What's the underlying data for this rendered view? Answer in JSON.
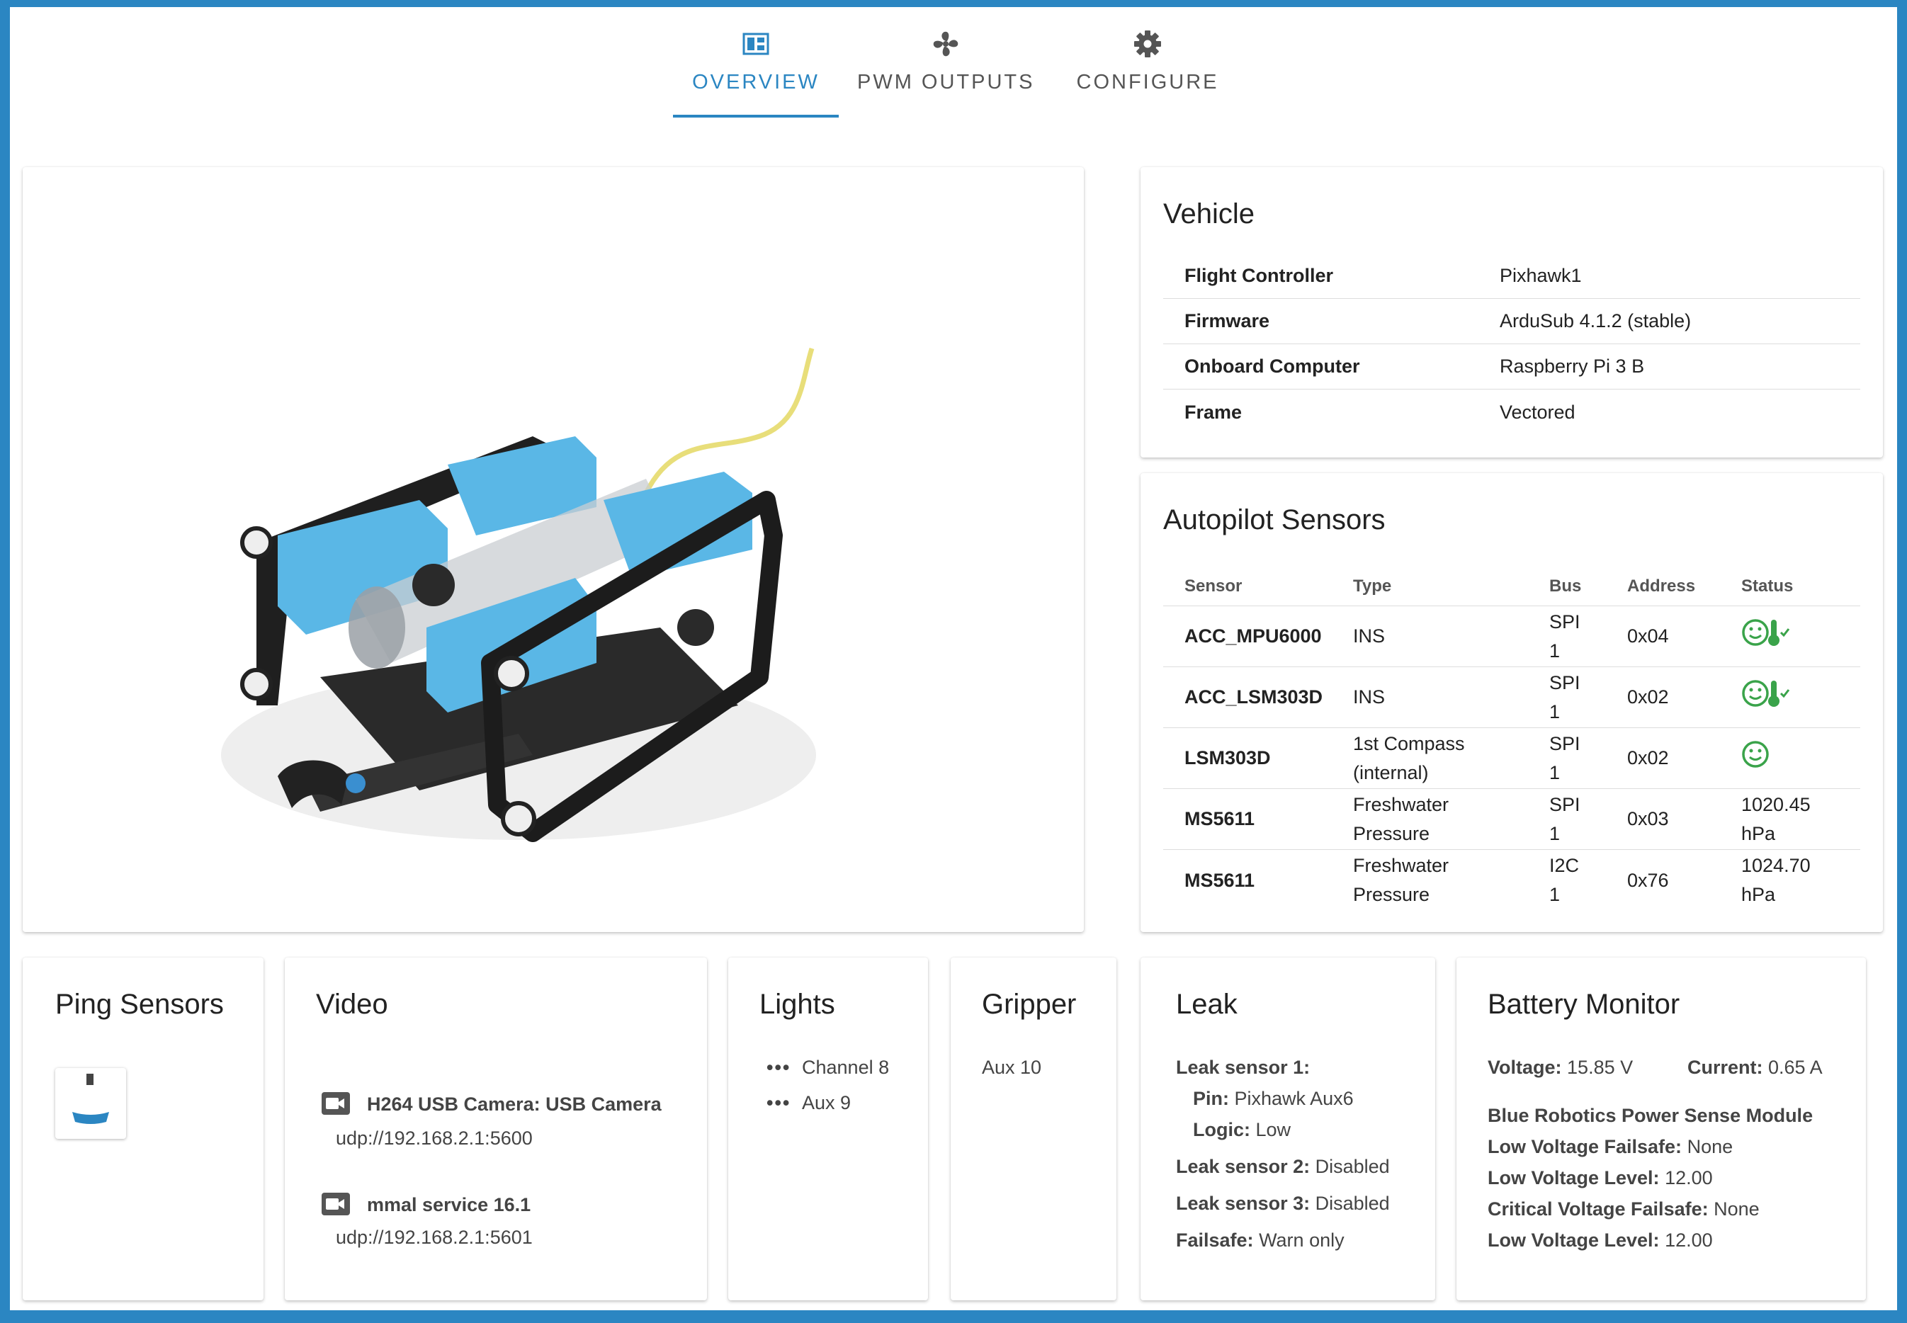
{
  "tabs": [
    {
      "label": "OVERVIEW",
      "icon": "dashboard-icon",
      "active": true
    },
    {
      "label": "PWM OUTPUTS",
      "icon": "fan-icon",
      "active": false
    },
    {
      "label": "CONFIGURE",
      "icon": "gear-icon",
      "active": false
    }
  ],
  "vehicle": {
    "title": "Vehicle",
    "rows": [
      {
        "key": "Flight Controller",
        "value": "Pixhawk1"
      },
      {
        "key": "Firmware",
        "value": "ArduSub 4.1.2 (stable)"
      },
      {
        "key": "Onboard Computer",
        "value": "Raspberry Pi 3 B"
      },
      {
        "key": "Frame",
        "value": "Vectored"
      }
    ]
  },
  "sensors": {
    "title": "Autopilot Sensors",
    "headers": [
      "Sensor",
      "Type",
      "Bus",
      "Address",
      "Status"
    ],
    "rows": [
      {
        "sensor": "ACC_MPU6000",
        "type": [
          "INS",
          ""
        ],
        "bus": [
          "SPI",
          "1"
        ],
        "address": "0x04",
        "status": "ok+temp"
      },
      {
        "sensor": "ACC_LSM303D",
        "type": [
          "INS",
          ""
        ],
        "bus": [
          "SPI",
          "1"
        ],
        "address": "0x02",
        "status": "ok+temp"
      },
      {
        "sensor": "LSM303D",
        "type": [
          "1st Compass",
          "(internal)"
        ],
        "bus": [
          "SPI",
          "1"
        ],
        "address": "0x02",
        "status": "ok"
      },
      {
        "sensor": "MS5611",
        "type": [
          "Freshwater",
          "Pressure"
        ],
        "bus": [
          "SPI",
          "1"
        ],
        "address": "0x03",
        "status_text": [
          "1020.45",
          "hPa"
        ]
      },
      {
        "sensor": "MS5611",
        "type": [
          "Freshwater",
          "Pressure"
        ],
        "bus": [
          "I2C",
          "1"
        ],
        "address": "0x76",
        "status_text": [
          "1024.70",
          "hPa"
        ]
      }
    ]
  },
  "ping": {
    "title": "Ping Sensors"
  },
  "video": {
    "title": "Video",
    "streams": [
      {
        "name": "H264 USB Camera: USB Camera",
        "url": "udp://192.168.2.1:5600"
      },
      {
        "name": "mmal service 16.1",
        "url": "udp://192.168.2.1:5601"
      }
    ]
  },
  "lights": {
    "title": "Lights",
    "items": [
      "Channel 8",
      "Aux 9"
    ]
  },
  "gripper": {
    "title": "Gripper",
    "value": "Aux 10"
  },
  "leak": {
    "title": "Leak",
    "s1_label": "Leak sensor 1:",
    "pin_label": "Pin:",
    "pin_value": "Pixhawk Aux6",
    "logic_label": "Logic:",
    "logic_value": "Low",
    "s2_label": "Leak sensor 2:",
    "s2_value": "Disabled",
    "s3_label": "Leak sensor 3:",
    "s3_value": "Disabled",
    "failsafe_label": "Failsafe:",
    "failsafe_value": "Warn only"
  },
  "battery": {
    "title": "Battery Monitor",
    "voltage_label": "Voltage:",
    "voltage_value": "15.85 V",
    "current_label": "Current:",
    "current_value": "0.65 A",
    "module": "Blue Robotics Power Sense Module",
    "lvf_label": "Low Voltage Failsafe:",
    "lvf_value": "None",
    "lvl_label": "Low Voltage Level:",
    "lvl_value": "12.00",
    "cvf_label": "Critical Voltage Failsafe:",
    "cvf_value": "None",
    "lvl2_label": "Low Voltage Level:",
    "lvl2_value": "12.00"
  },
  "colors": {
    "accent": "#2b86c2",
    "ok": "#3aa34a",
    "rov_blue": "#5ab7e6"
  }
}
